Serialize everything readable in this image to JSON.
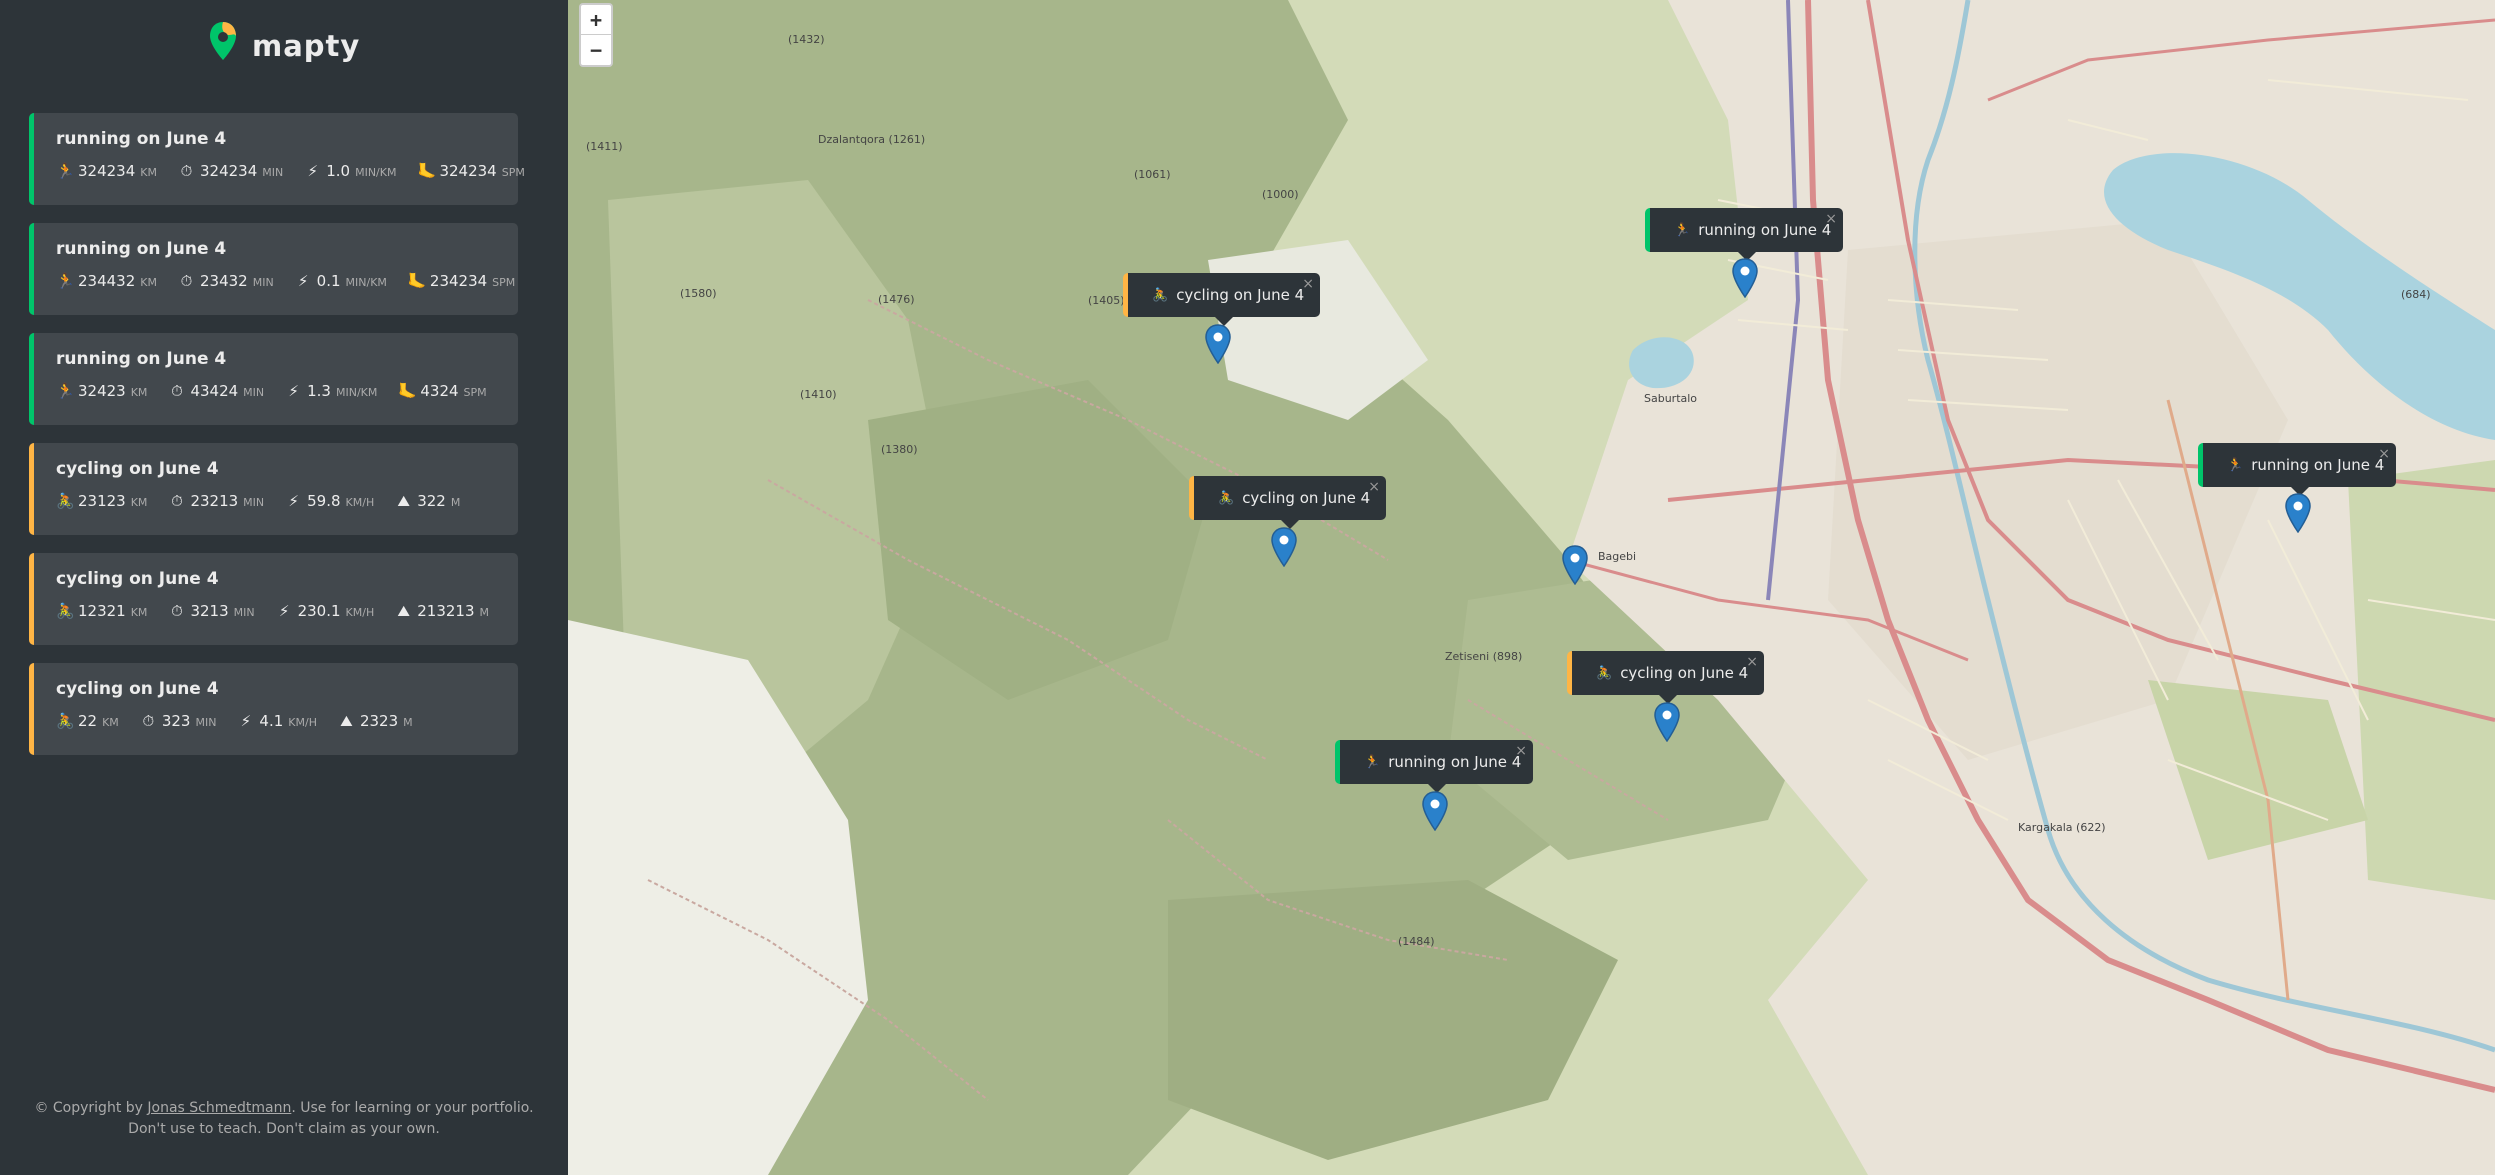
{
  "app": {
    "name": "mapty"
  },
  "workouts": [
    {
      "type": "running",
      "title": "running on June 4",
      "details": [
        {
          "icon": "🏃",
          "value": "324234",
          "unit": "km"
        },
        {
          "icon": "⏱",
          "value": "324234",
          "unit": "min"
        },
        {
          "icon": "⚡",
          "value": "1.0",
          "unit": "min/km"
        },
        {
          "icon": "🦶",
          "value": "324234",
          "unit": "spm"
        }
      ]
    },
    {
      "type": "running",
      "title": "running on June 4",
      "details": [
        {
          "icon": "🏃",
          "value": "234432",
          "unit": "km"
        },
        {
          "icon": "⏱",
          "value": "23432",
          "unit": "min"
        },
        {
          "icon": "⚡",
          "value": "0.1",
          "unit": "min/km"
        },
        {
          "icon": "🦶",
          "value": "234234",
          "unit": "spm"
        }
      ]
    },
    {
      "type": "running",
      "title": "running on June 4",
      "details": [
        {
          "icon": "🏃",
          "value": "32423",
          "unit": "km"
        },
        {
          "icon": "⏱",
          "value": "43424",
          "unit": "min"
        },
        {
          "icon": "⚡",
          "value": "1.3",
          "unit": "min/km"
        },
        {
          "icon": "🦶",
          "value": "4324",
          "unit": "spm"
        }
      ]
    },
    {
      "type": "cycling",
      "title": "cycling on June 4",
      "details": [
        {
          "icon": "🚴",
          "value": "23123",
          "unit": "km"
        },
        {
          "icon": "⏱",
          "value": "23213",
          "unit": "min"
        },
        {
          "icon": "⚡",
          "value": "59.8",
          "unit": "km/h"
        },
        {
          "icon": "⛰",
          "value": "322",
          "unit": "m"
        }
      ]
    },
    {
      "type": "cycling",
      "title": "cycling on June 4",
      "details": [
        {
          "icon": "🚴",
          "value": "12321",
          "unit": "km"
        },
        {
          "icon": "⏱",
          "value": "3213",
          "unit": "min"
        },
        {
          "icon": "⚡",
          "value": "230.1",
          "unit": "km/h"
        },
        {
          "icon": "⛰",
          "value": "213213",
          "unit": "m"
        }
      ]
    },
    {
      "type": "cycling",
      "title": "cycling on June 4",
      "details": [
        {
          "icon": "🚴",
          "value": "22",
          "unit": "km"
        },
        {
          "icon": "⏱",
          "value": "323",
          "unit": "min"
        },
        {
          "icon": "⚡",
          "value": "4.1",
          "unit": "km/h"
        },
        {
          "icon": "⛰",
          "value": "2323",
          "unit": "m"
        }
      ]
    }
  ],
  "copyright": {
    "prefix": "© Copyright by ",
    "author": "Jonas Schmedtmann",
    "suffix": ". Use for learning or your portfolio. Don't use to teach. Don't claim as your own."
  },
  "map": {
    "zoom_in": "+",
    "zoom_out": "−",
    "popups": [
      {
        "type": "running",
        "icon": "🏃",
        "label": "running on June 4",
        "close": "×"
      },
      {
        "type": "cycling",
        "icon": "🚴",
        "label": "cycling on June 4",
        "close": "×"
      },
      {
        "type": "cycling",
        "icon": "🚴",
        "label": "cycling on June 4",
        "close": "×"
      },
      {
        "type": "running",
        "icon": "🏃",
        "label": "running on June 4",
        "close": "×"
      },
      {
        "type": "cycling",
        "icon": "🚴",
        "label": "cycling on June 4",
        "close": "×"
      },
      {
        "type": "running",
        "icon": "🏃",
        "label": "running on June 4",
        "close": "×"
      }
    ],
    "place_labels": [
      "Dzalantqora (1261)",
      "(1061)",
      "(1000)",
      "(1405)",
      "(1476)",
      "(1580)",
      "(1410)",
      "(1380)",
      "Saburtalo",
      "Bagebi",
      "Zetiseni (898)",
      "Kargakala (622)",
      "(1484)",
      "(684)",
      "(1411)",
      "(1432)"
    ]
  },
  "colors": {
    "running": "#00c46a",
    "cycling": "#ffb545",
    "sidebar": "#2d3439",
    "card": "#42484d"
  }
}
